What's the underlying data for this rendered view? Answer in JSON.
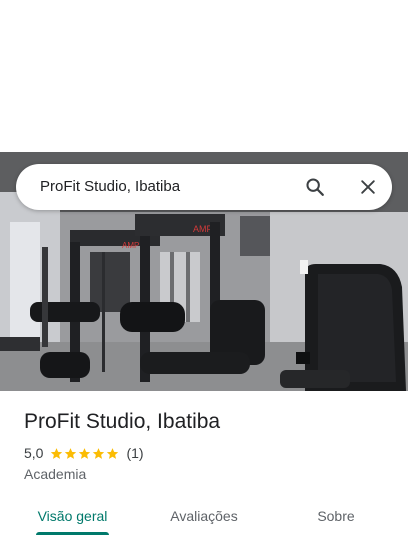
{
  "search": {
    "query": "ProFit Studio, Ibatiba",
    "search_icon": "search-icon",
    "clear_icon": "close-icon"
  },
  "photo": {
    "equipment_brand_left": "AMP",
    "equipment_brand_right": "AMP"
  },
  "place": {
    "title": "ProFit Studio, Ibatiba",
    "rating": "5,0",
    "stars": 5,
    "review_count": "(1)",
    "category": "Academia"
  },
  "tabs": [
    {
      "label": "Visão geral",
      "active": true
    },
    {
      "label": "Avaliações",
      "active": false
    },
    {
      "label": "Sobre",
      "active": false
    }
  ],
  "colors": {
    "accent": "#00796b",
    "star": "#fbbc04",
    "text_primary": "#202124",
    "text_secondary": "#5f6368"
  }
}
